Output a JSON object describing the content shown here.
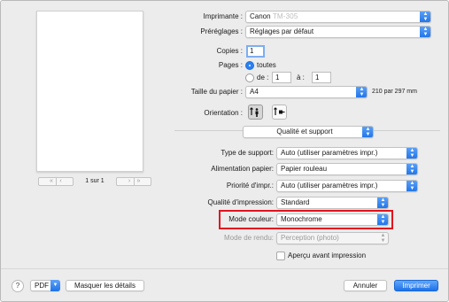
{
  "printer": {
    "label": "Imprimante :",
    "value": "Canon",
    "model_blurred": "TM-305"
  },
  "presets": {
    "label": "Préréglages :",
    "value": "Réglages par défaut"
  },
  "copies": {
    "label": "Copies :",
    "value": "1"
  },
  "pages": {
    "label": "Pages :",
    "all_label": "toutes",
    "from_label": "de :",
    "from_value": "1",
    "to_label": "à :",
    "to_value": "1"
  },
  "paper_size": {
    "label": "Taille du papier :",
    "value": "A4",
    "dimensions": "210 par 297 mm"
  },
  "orientation": {
    "label": "Orientation :",
    "selected": "portrait"
  },
  "section": {
    "value": "Qualité et support"
  },
  "media_type": {
    "label": "Type de support:",
    "value": "Auto (utiliser paramètres impr.)"
  },
  "paper_source": {
    "label": "Alimentation papier:",
    "value": "Papier rouleau"
  },
  "print_priority": {
    "label": "Priorité d'impr.:",
    "value": "Auto (utiliser paramètres impr.)"
  },
  "print_quality": {
    "label": "Qualité d'impression:",
    "value": "Standard"
  },
  "color_mode": {
    "label": "Mode couleur:",
    "value": "Monochrome",
    "highlight_color": "#e0141e"
  },
  "rendering_mode": {
    "label": "Mode de rendu:",
    "value": "Perception (photo)"
  },
  "preview_option": {
    "label": "Aperçu avant impression",
    "checked": false
  },
  "preview": {
    "page_indicator": "1 sur 1"
  },
  "footer": {
    "help": "?",
    "pdf_label": "PDF",
    "hide_details": "Masquer les détails",
    "cancel": "Annuler",
    "print": "Imprimer"
  },
  "colors": {
    "accent": "#1d72e9",
    "background": "#ececec"
  }
}
